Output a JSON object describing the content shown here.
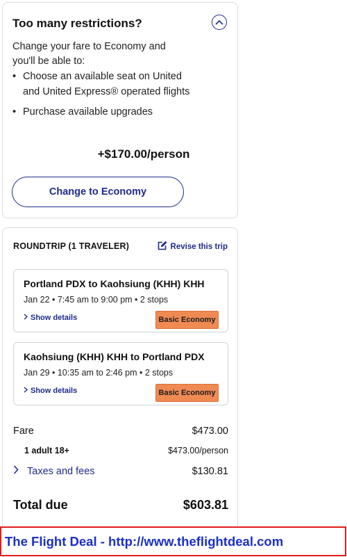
{
  "upsell": {
    "title": "Too many restrictions?",
    "intro": "Change your fare to Economy and you'll be able to:",
    "bullets": [
      "Choose an available seat on United and United Express® operated flights",
      "Purchase available upgrades"
    ],
    "price": "+$170.00/person",
    "button_label": "Change to Economy",
    "collapse_icon": "chevron-up-icon"
  },
  "summary": {
    "title": "ROUNDTRIP (1 TRAVELER)",
    "revise_label": "Revise this trip",
    "revise_icon": "edit-icon",
    "flights": [
      {
        "route": "Portland PDX to Kaohsiung (KHH) KHH",
        "times": "Jan 22 • 7:45 am to 9:00 pm • 2 stops",
        "details_label": "Show details",
        "fare_class": "Basic Economy"
      },
      {
        "route": "Kaohsiung (KHH) KHH to Portland PDX",
        "times": "Jan 29 • 10:35 am to 2:46 pm • 2 stops",
        "details_label": "Show details",
        "fare_class": "Basic Economy"
      }
    ],
    "fare_label": "Fare",
    "fare_value": "$473.00",
    "adult_label": "1 adult 18+",
    "adult_value": "$473.00/person",
    "taxes_label": "Taxes and fees",
    "taxes_value": "$130.81",
    "total_label": "Total due",
    "total_value": "$603.81"
  },
  "banner": {
    "text": "The Flight Deal - http://www.theflightdeal.com"
  },
  "colors": {
    "brand_blue": "#1d2b8b",
    "fare_badge": "#ef8a53",
    "banner_border": "#e31b1b",
    "banner_text": "#1a2fc9"
  }
}
